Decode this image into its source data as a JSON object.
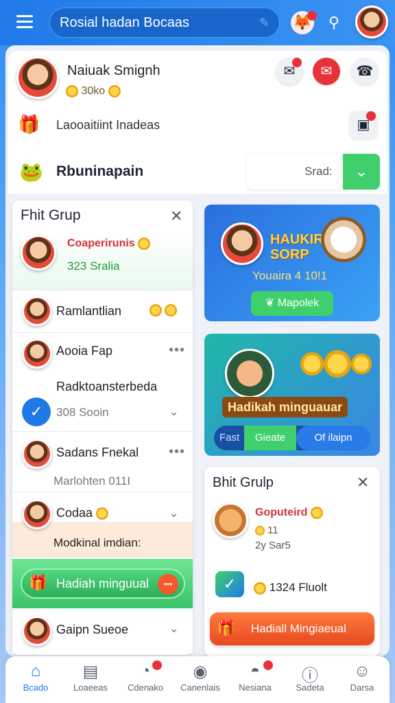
{
  "topbar": {
    "search_text": "Rosial hadan Bocaas",
    "icons": [
      "menu-icon",
      "fox-mascot-icon",
      "search-icon",
      "avatar"
    ]
  },
  "profile": {
    "name": "Naiuak Smignh",
    "coins": "30ko",
    "items_label": "Laooaitiint Inadeas"
  },
  "section": {
    "title": "Rbuninapain",
    "pill_text": "Srad:"
  },
  "left_card": {
    "title": "Fhit Grup",
    "featured": {
      "name": "Coaperirunis",
      "sub": "323 Sralia"
    },
    "rows": [
      {
        "name": "Ramlantlian"
      },
      {
        "name": "Aooia Fap",
        "sub": "Radktoansterbeda",
        "meta": "308 Sooin"
      },
      {
        "name": "Sadans Fnekal",
        "sub": "Marlohten 011I"
      },
      {
        "name": "Codaa",
        "sub": "Modkinal imdian:"
      },
      {
        "name": "Gaipn Sueoe"
      }
    ],
    "cta": "Hadiah minguual"
  },
  "promo1": {
    "title_line1": "HAUKIR",
    "title_line2": "SORP",
    "subtitle": "Youaira 4 10!1",
    "button": "Mapolek"
  },
  "promo2": {
    "banner": "Hadikah minguauar",
    "seg": [
      "Fast",
      "Gieate",
      "Of ilaipn"
    ]
  },
  "right_card": {
    "title": "Bhit Grulp",
    "name": "Goputeird",
    "line1": "11",
    "line2": "2y Sar5",
    "points": "1324 Fluolt",
    "cta": "Hadiall Mingiaeual"
  },
  "nav": [
    {
      "label": "Bcado",
      "icon": "home-icon",
      "active": true
    },
    {
      "label": "Loaeeas",
      "icon": "document-icon"
    },
    {
      "label": "Cdenako",
      "icon": "chat-icon"
    },
    {
      "label": "Canenlais",
      "icon": "location-icon"
    },
    {
      "label": "Nesiana",
      "icon": "notification-icon"
    },
    {
      "label": "Sadeta",
      "icon": "info-icon"
    },
    {
      "label": "Darsa",
      "icon": "profile-icon"
    }
  ],
  "colors": {
    "primary": "#1f7ae8",
    "green": "#3fd06d",
    "orange": "#f25a2b",
    "red": "#e7323a"
  }
}
